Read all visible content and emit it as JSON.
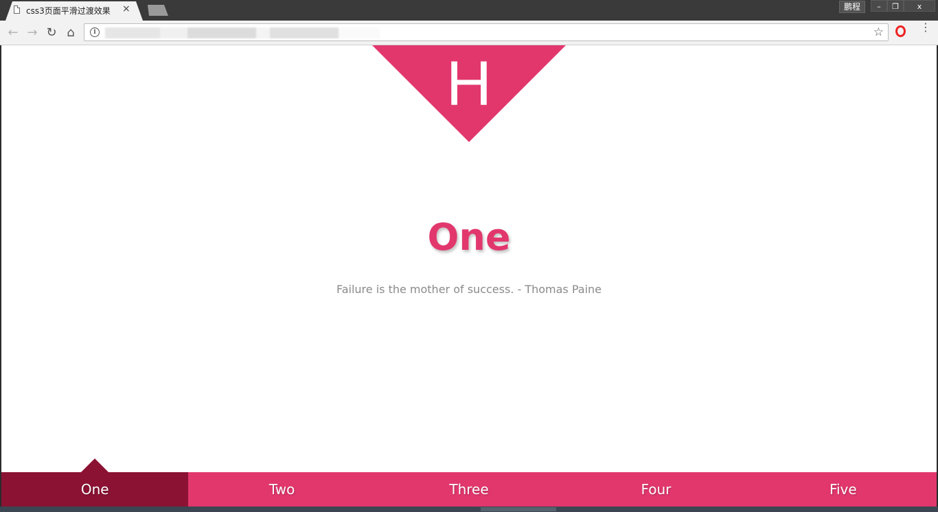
{
  "browser": {
    "tab_title": "css3页面平滑过渡效果",
    "tab_close": "×",
    "profile_label": "鹏程",
    "window_min": "–",
    "window_max": "❐",
    "window_close": "x",
    "url": "",
    "icons": {
      "back": "←",
      "forward": "→",
      "reload": "↻",
      "home": "⌂",
      "info": "i",
      "star": "☆",
      "menu": "⋮"
    }
  },
  "page": {
    "logo_letter": "H",
    "heading": "One",
    "quote": "Failure is the mother of success. - Thomas Paine",
    "nav": [
      {
        "label": "One",
        "active": true
      },
      {
        "label": "Two",
        "active": false
      },
      {
        "label": "Three",
        "active": false
      },
      {
        "label": "Four",
        "active": false
      },
      {
        "label": "Five",
        "active": false
      }
    ]
  },
  "colors": {
    "accent": "#e2376d",
    "active_nav": "#8b1233",
    "quote_text": "#8a8a8a"
  }
}
